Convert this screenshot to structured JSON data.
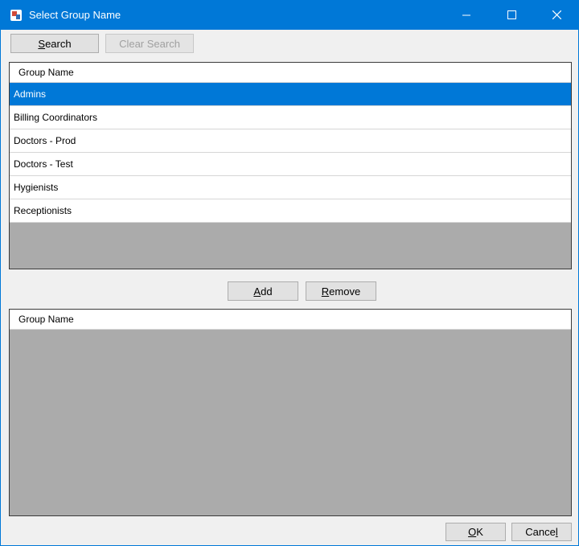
{
  "window": {
    "title": "Select Group Name",
    "controls": {
      "minimize": "—",
      "maximize": "☐",
      "close": "✕"
    }
  },
  "toolbar": {
    "search_pre": "",
    "search_mnemonic": "S",
    "search_post": "earch",
    "clear_search": "Clear Search",
    "clear_search_enabled": false
  },
  "available_grid": {
    "column_header": "Group Name",
    "rows": [
      {
        "name": "Admins",
        "selected": true
      },
      {
        "name": "Billing Coordinators",
        "selected": false
      },
      {
        "name": "Doctors - Prod",
        "selected": false
      },
      {
        "name": "Doctors - Test",
        "selected": false
      },
      {
        "name": "Hygienists",
        "selected": false
      },
      {
        "name": "Receptionists",
        "selected": false
      }
    ]
  },
  "middle_buttons": {
    "add_pre": "",
    "add_mnemonic": "A",
    "add_post": "dd",
    "remove_pre": "",
    "remove_mnemonic": "R",
    "remove_post": "emove"
  },
  "selected_grid": {
    "column_header": "Group Name",
    "rows": []
  },
  "footer": {
    "ok_pre": "",
    "ok_mnemonic": "O",
    "ok_post": "K",
    "cancel_pre": "Cance",
    "cancel_mnemonic": "l",
    "cancel_post": ""
  },
  "colors": {
    "titlebar": "#0078d7",
    "selection": "#0078d7",
    "grid_empty": "#ababab",
    "dialog_bg": "#f0f0f0"
  },
  "icons": {
    "app": "key-app-icon",
    "minimize": "minimize-icon",
    "maximize": "maximize-icon",
    "close": "close-icon"
  }
}
